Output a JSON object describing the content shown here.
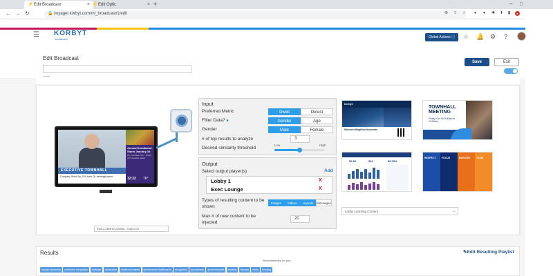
{
  "browser": {
    "tabs": [
      {
        "label": "Edit Broadcast",
        "active": true
      },
      {
        "label": "Edit Optic",
        "active": false
      }
    ],
    "url": "voyager.korbyt.com/ml_broadcast/1/edit"
  },
  "colors": {
    "primary": "#1c4e8a",
    "accent": "#2e9ee8",
    "stripe": [
      "#c2185b",
      "#f4c20d",
      "#1e88e5"
    ]
  },
  "app": {
    "logo": "KORBYT",
    "logo_sub": "broadcast",
    "global_actions_label": "Global Actions"
  },
  "page": {
    "title": "Edit Broadcast",
    "name_value": "",
    "small_label": "Small",
    "save_label": "Save",
    "exit_label": "Exit"
  },
  "preview": {
    "exec_banner": "EXECUTIVE TOWNHALL",
    "ticker": "Company Stock Up 13% from Q1 earnings report.",
    "enroll_title": "Annual Enrollment Starts January 10",
    "enroll_sub": "Do Your Best You... Finish your benefits today!",
    "time": "12:22",
    "temp": "76°",
    "device_label": "9WILLOBBHS1026MA - Output #1"
  },
  "input_panel": {
    "title": "Input",
    "preferred_metric_label": "Preferred Metric",
    "metric_options": [
      "Dwell",
      "Detect"
    ],
    "filter_label": "Filter Data?",
    "filter_options": [
      "Gender",
      "Age"
    ],
    "gender_label": "Gender",
    "gender_options": [
      "Male",
      "Female"
    ],
    "top_results_label": "# of top results to analyze",
    "top_results_value": "3",
    "similarity_label": "Desired similarity threshold",
    "slider_low": "Low",
    "slider_high": "High",
    "similarity_level": 0.5
  },
  "output_panel": {
    "title": "Output",
    "select_label": "Select output player(s)",
    "add_label": "Add",
    "players": [
      "Lobby 1",
      "Exec Lounge"
    ],
    "remove_glyph": "X",
    "types_label": "Types of resulting content to be shown",
    "type_options": [
      "Images",
      "Videos",
      "Layouts",
      "Messages"
    ],
    "max_label": "Max # of new content to be injected",
    "max_value": "20"
  },
  "dropdown": {
    "value": "Lobby Learning Content"
  },
  "thumbnails": {
    "t1_logo": "korbyt",
    "t1_welcome": "Welcome Brighton Associate",
    "t2_title": "TOWNHALL MEETING",
    "t2_sub": "Friday, Oct 16 8:00am to 10:00am",
    "t3_stats": [
      "50.53",
      "$31",
      "85.25%"
    ],
    "t3_bars": [
      0.4,
      0.6,
      0.75,
      0.55,
      0.8,
      0.5,
      0.9,
      0.7
    ],
    "t3_bars2": [
      0.5,
      0.7,
      0.6,
      0.8,
      0.5,
      0.65,
      0.75,
      0.6
    ],
    "t4_labels": [
      "RESPECT",
      "FOCUS",
      "EMPATHY",
      "TEAM"
    ],
    "t4_colors": [
      "#1c4ea8",
      "#0f2d6e",
      "#e8701a",
      "#f28c28"
    ]
  },
  "results": {
    "title": "Results",
    "edit_playlist": "Edit Resulting Playlist",
    "recommended": "Recommended for you",
    "tags": [
      "human resources",
      "workforce recognition",
      "holidays",
      "celebration",
      "health and safety",
      "performance dashboards",
      "recognition",
      "anniversary",
      "announcement",
      "weather",
      "livecast",
      "news",
      "trending"
    ]
  }
}
